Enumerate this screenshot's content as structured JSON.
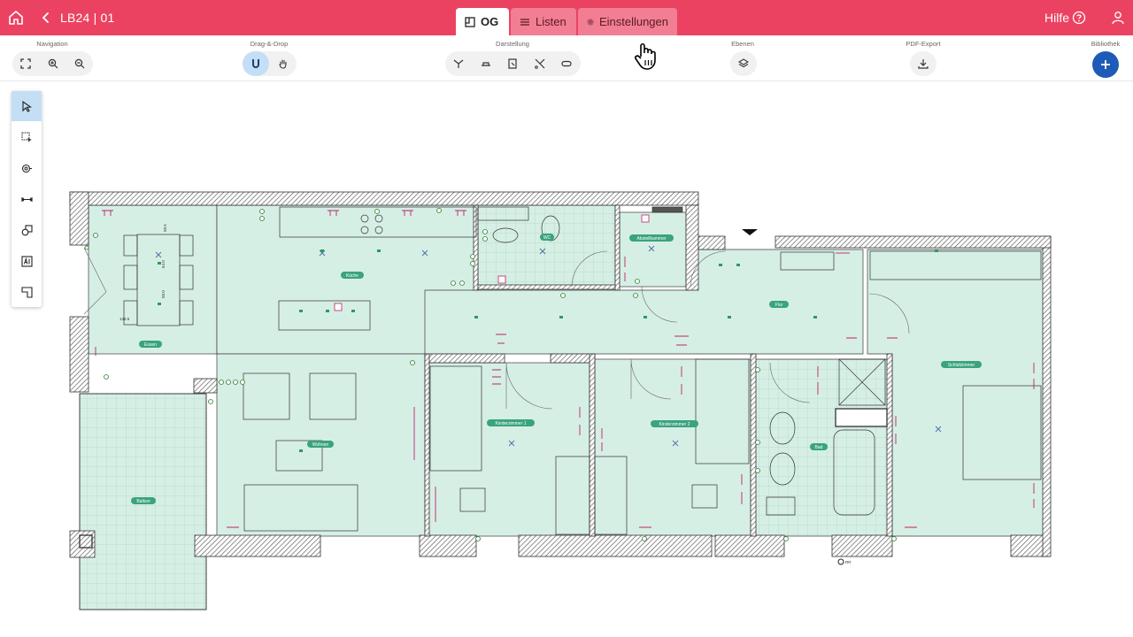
{
  "app": {
    "project_title": "LB24 | 01",
    "help_label": "Hilfe"
  },
  "tabs": [
    {
      "label": "OG",
      "active": true
    },
    {
      "label": "Listen",
      "active": false
    },
    {
      "label": "Einstellungen",
      "active": false
    }
  ],
  "toolbar": {
    "groups": {
      "navigation": "Navigation",
      "dragdrop": "Drag-&-Drop",
      "darstellung": "Darstellung",
      "ebenen": "Ebenen",
      "pdf": "PDF-Export",
      "bibliothek": "Bibliothek"
    },
    "icons": {
      "navigation": [
        "fit-screen-icon",
        "zoom-in-icon",
        "zoom-out-icon"
      ],
      "dragdrop": [
        "magnet-icon",
        "hand-icon"
      ],
      "darstellung": [
        "pipe-junction-icon",
        "wall-socket-icon",
        "door-icon",
        "cable-cut-icon",
        "capsule-icon"
      ],
      "ebenen": [
        "layers-icon"
      ],
      "pdf": [
        "download-icon"
      ],
      "bibliothek": [
        "plus-icon"
      ]
    }
  },
  "palette": {
    "tools": [
      "select-arrow-icon",
      "area-select-icon",
      "wall-outlet-icon",
      "measure-icon",
      "shapes-icon",
      "text-ai-icon",
      "door-frame-icon"
    ],
    "active_tool": "select-arrow-icon"
  },
  "plan": {
    "rooms": [
      "Essen",
      "Küche",
      "Wohnen",
      "Balkon",
      "WC",
      "Abstellkammer",
      "Flur",
      "Kinderzimmer 1",
      "Kinderzimmer 2",
      "Bad",
      "Schlafzimmer"
    ],
    "dimensions": [
      "58.5",
      "64.0",
      "58.0",
      "138.5"
    ],
    "misc_labels": [
      "RR"
    ]
  },
  "colors": {
    "topbar": "#ec4261",
    "tab_inactive": "#f27e93",
    "room_fill": "#d6efe5",
    "room_label": "#3aa37f",
    "active_tool": "#c4dff5",
    "bibliothek_button": "#1e5bb8"
  }
}
